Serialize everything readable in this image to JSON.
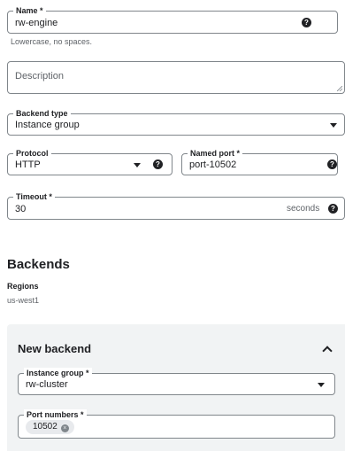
{
  "name_field": {
    "label": "Name *",
    "value": "rw-engine",
    "hint": "Lowercase, no spaces.",
    "help_icon": "help-icon"
  },
  "description_field": {
    "placeholder": "Description"
  },
  "backend_type_field": {
    "label": "Backend type",
    "value": "Instance group"
  },
  "protocol_field": {
    "label": "Protocol",
    "value": "HTTP"
  },
  "named_port_field": {
    "label": "Named port *",
    "value": "port-10502"
  },
  "timeout_field": {
    "label": "Timeout *",
    "value": "30",
    "suffix": "seconds"
  },
  "backends": {
    "title": "Backends",
    "regions_label": "Regions",
    "region_value": "us-west1"
  },
  "new_backend": {
    "title": "New backend",
    "instance_group": {
      "label": "Instance group *",
      "value": "rw-cluster"
    },
    "port_numbers": {
      "label": "Port numbers *",
      "chips": [
        "10502"
      ]
    }
  },
  "help_glyph": "?",
  "chip_remove_glyph": "×",
  "colors": {
    "panel_bg": "#f1f3f4",
    "border": "#80868b",
    "text": "#202124",
    "muted": "#5f6368"
  }
}
